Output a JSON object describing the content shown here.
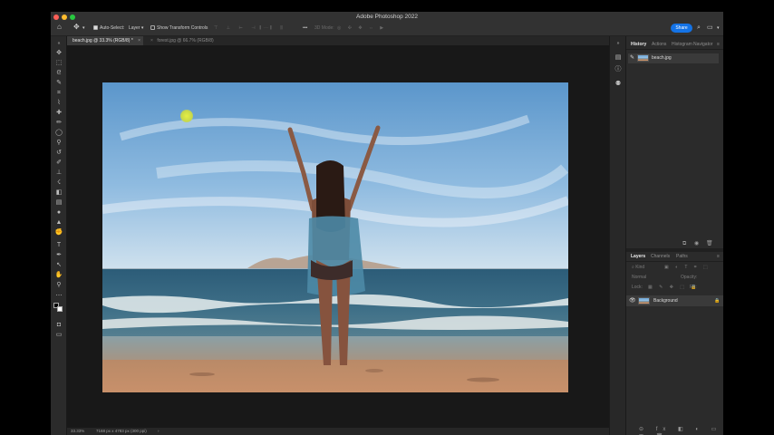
{
  "window": {
    "title": "Adobe Photoshop 2022"
  },
  "options_bar": {
    "auto_select_label": "Auto-Select:",
    "auto_select_value": "Layer",
    "show_transform_label": "Show Transform Controls",
    "mode_3d_label": "3D Mode:",
    "share_label": "Share"
  },
  "tabs": [
    {
      "label": "beach.jpg @ 33.3% (RGB/8) *"
    },
    {
      "label": "forest.jpg @ 66.7% (RGB/8)"
    }
  ],
  "status_bar": {
    "zoom": "33.33%",
    "doc_info": "7168 px x 4783 px (300 ppi)",
    "arrow": "›"
  },
  "history_panel": {
    "tabs": [
      "History",
      "Actions",
      "Histogram",
      "Navigator"
    ],
    "items": [
      {
        "label": "beach.jpg"
      }
    ]
  },
  "layers_panel": {
    "tabs": [
      "Layers",
      "Channels",
      "Paths"
    ],
    "kind_placeholder": "Kind",
    "blend_mode": "Normal",
    "opacity_label": "Opacity:",
    "lock_label": "Lock:",
    "fill_label": "Fill:",
    "layers": [
      {
        "name": "Background",
        "visible": true,
        "locked": true
      }
    ]
  },
  "colors": {
    "accent": "#1473e6",
    "chrome": "#323232",
    "panel": "#2b2b2b",
    "canvas_bg": "#181818"
  }
}
